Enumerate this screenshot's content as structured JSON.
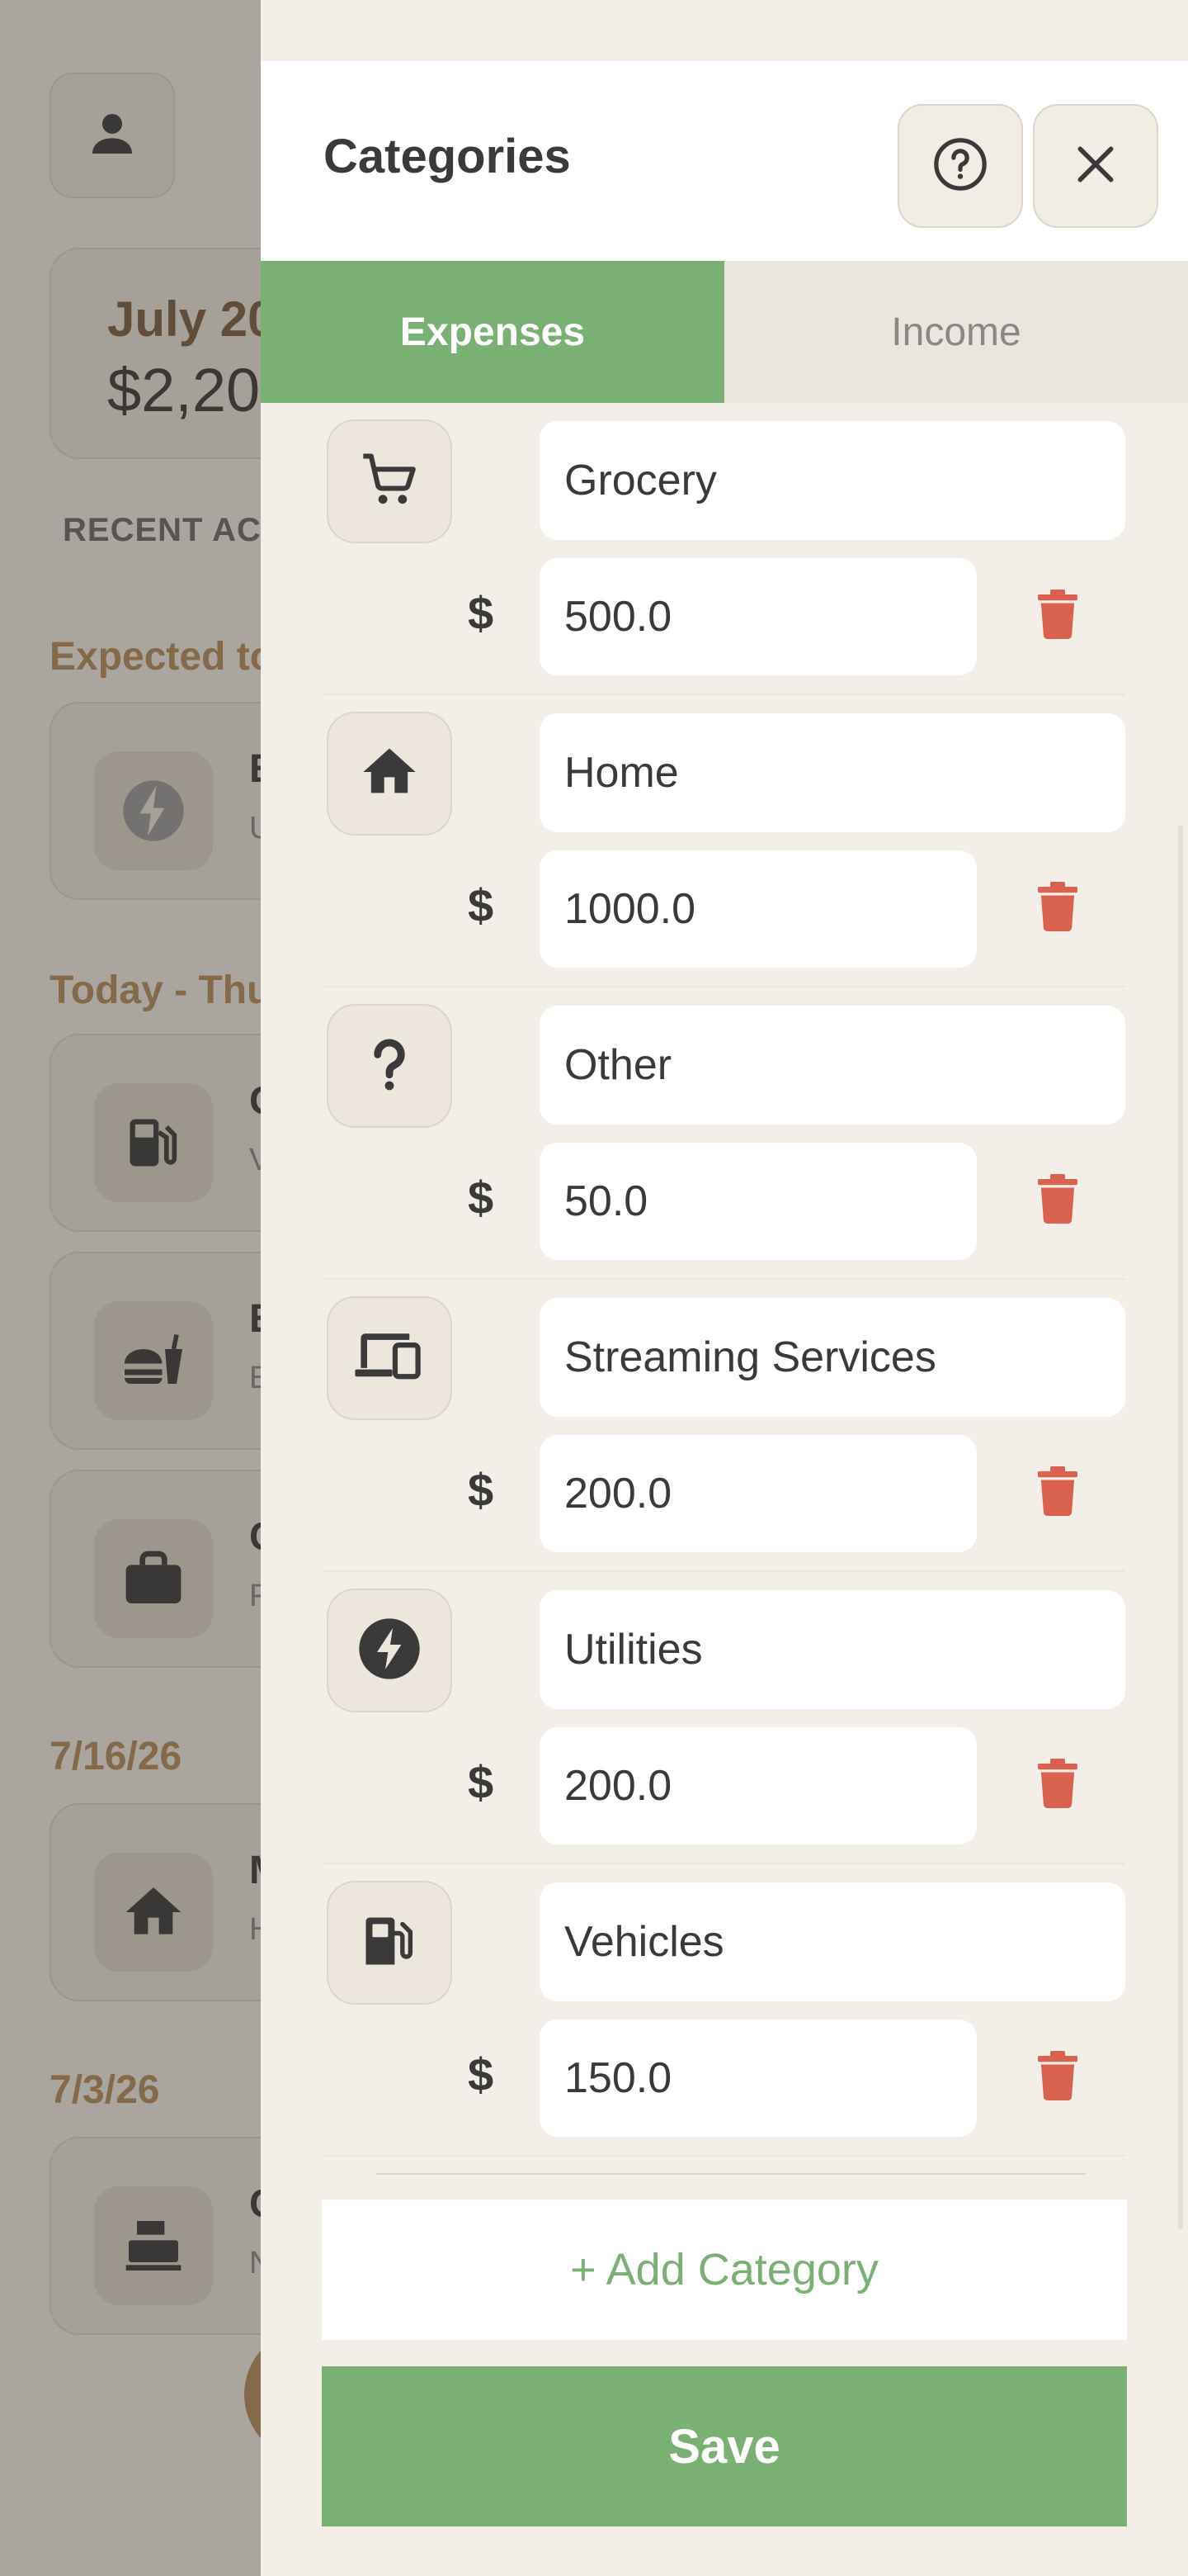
{
  "colors": {
    "accent": "#7bb074",
    "danger": "#d9614f",
    "brown": "#b48a5a",
    "sheet_bg": "#f3efe8"
  },
  "background": {
    "profile_icon": "person-icon",
    "summary": {
      "month": "July 20",
      "amount": "$2,20"
    },
    "recent_label": "RECENT ACT",
    "sections": [
      "Expected to",
      "Today - Thu",
      "7/16/26",
      "7/3/26"
    ],
    "cards": [
      {
        "icon": "lightning-icon",
        "title": "E",
        "subtitle": "U"
      },
      {
        "icon": "fuel-icon",
        "title": "G",
        "subtitle": "V"
      },
      {
        "icon": "fastfood-icon",
        "title": "E",
        "subtitle": "E"
      },
      {
        "icon": "briefcase-icon",
        "title": "C",
        "subtitle": "F"
      },
      {
        "icon": "home-icon",
        "title": "M",
        "subtitle": "H"
      },
      {
        "icon": "register-icon",
        "title": "C",
        "subtitle": "N"
      }
    ]
  },
  "sheet": {
    "title": "Categories",
    "help_icon": "help-circle-icon",
    "close_icon": "close-icon",
    "tabs": [
      {
        "label": "Expenses",
        "active": true
      },
      {
        "label": "Income",
        "active": false
      }
    ],
    "currency_symbol": "$",
    "categories": [
      {
        "name": "Grocery",
        "amount": "500.0",
        "icon": "cart-icon"
      },
      {
        "name": "Home",
        "amount": "1000.0",
        "icon": "home-icon"
      },
      {
        "name": "Other",
        "amount": "50.0",
        "icon": "question-icon"
      },
      {
        "name": "Streaming Services",
        "amount": "200.0",
        "icon": "devices-icon"
      },
      {
        "name": "Utilities",
        "amount": "200.0",
        "icon": "lightning-icon"
      },
      {
        "name": "Vehicles",
        "amount": "150.0",
        "icon": "fuel-icon"
      }
    ],
    "add_label": "+ Add Category",
    "save_label": "Save"
  }
}
